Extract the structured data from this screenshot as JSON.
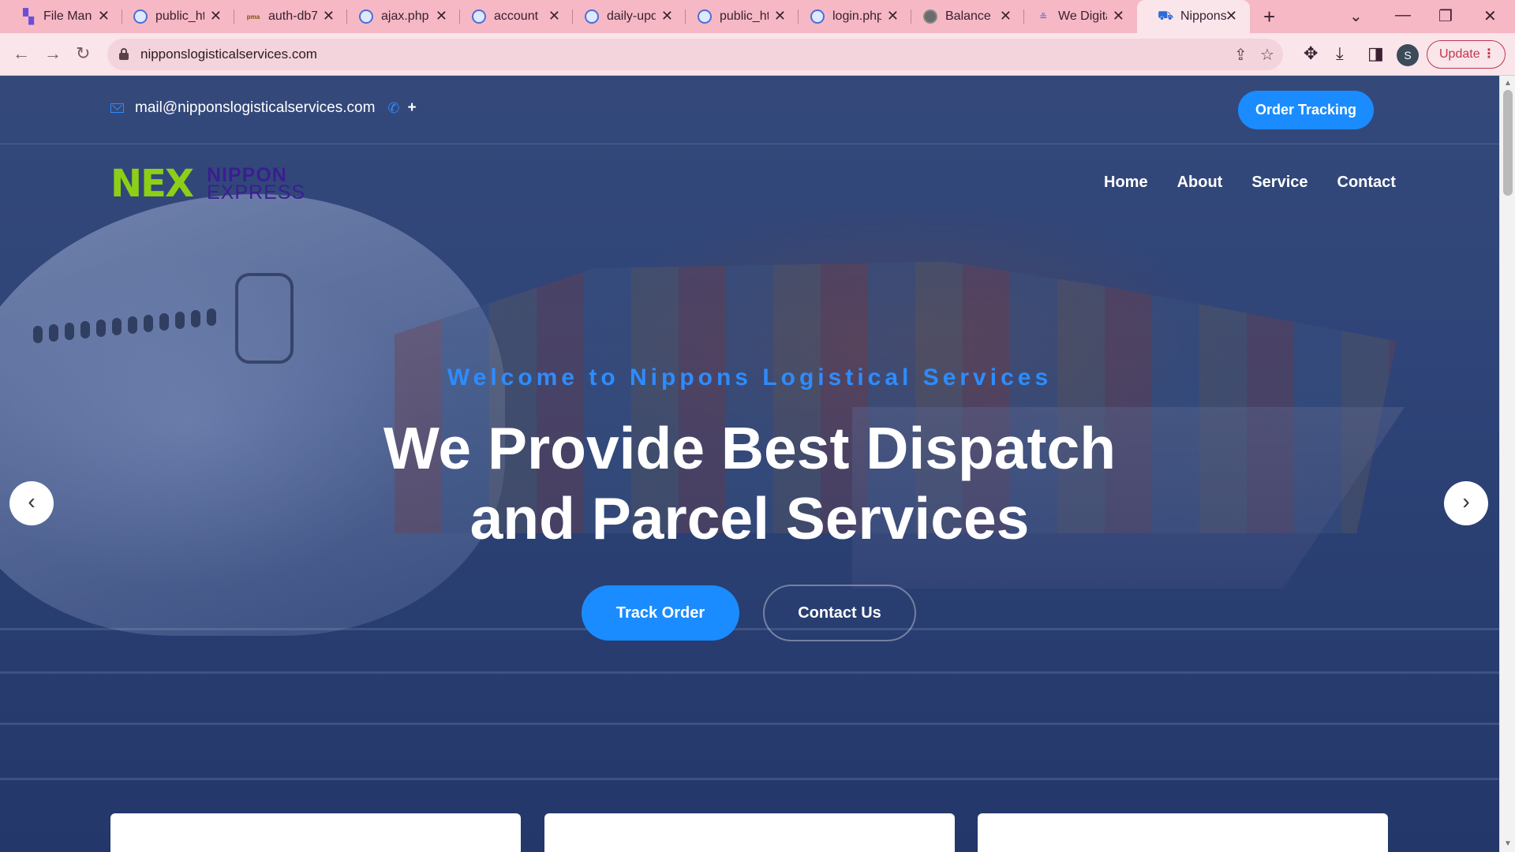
{
  "browser": {
    "tabs": [
      {
        "title": "File Manager",
        "favicon": "cpanel-icon"
      },
      {
        "title": "public_html",
        "favicon": "globe-icon"
      },
      {
        "title": "auth-db7",
        "favicon": "phpmyadmin-icon"
      },
      {
        "title": "ajax.php",
        "favicon": "globe-icon"
      },
      {
        "title": "account",
        "favicon": "globe-icon"
      },
      {
        "title": "daily-upd",
        "favicon": "globe-icon"
      },
      {
        "title": "public_ht",
        "favicon": "globe-icon"
      },
      {
        "title": "login.php",
        "favicon": "globe-icon"
      },
      {
        "title": "Balance",
        "favicon": "sphere-icon"
      },
      {
        "title": "We Digita",
        "favicon": "site-icon"
      },
      {
        "title": "Nippons",
        "favicon": "truck-icon"
      }
    ],
    "url": "nipponslogisticalservices.com",
    "profile_initial": "S",
    "update_label": "Update"
  },
  "topbar": {
    "email": "mail@nipponslogisticalservices.com",
    "phone": "+",
    "order_tracking_label": "Order Tracking"
  },
  "logo": {
    "mark": "NEX",
    "line1": "NIPPON",
    "line2": "EXPRESS"
  },
  "nav": {
    "items": [
      "Home",
      "About",
      "Service",
      "Contact"
    ]
  },
  "hero": {
    "eyebrow": "Welcome to Nippons Logistical Services",
    "title_line1": "We Provide Best Dispatch",
    "title_line2": "and Parcel Services",
    "primary_button": "Track Order",
    "secondary_button": "Contact Us"
  },
  "colors": {
    "accent": "#1a8cff",
    "tab_strip": "#f6b8c5",
    "toolbar": "#f9e5ea",
    "logo_green": "#8ccf16",
    "logo_purple": "#3a1e91"
  }
}
